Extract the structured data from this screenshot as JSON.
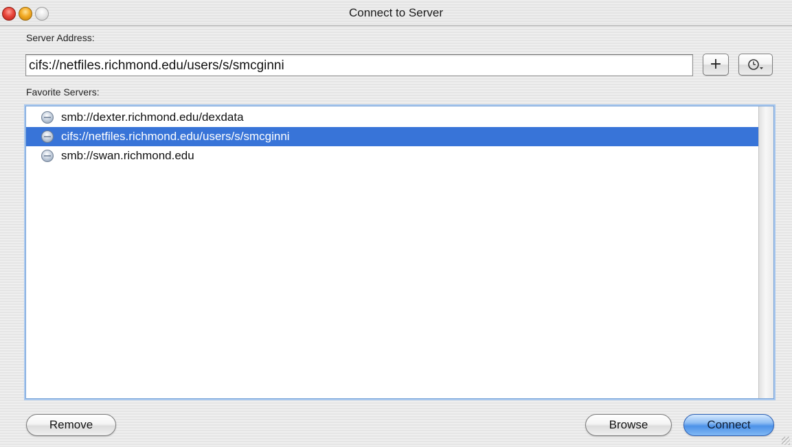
{
  "window": {
    "title": "Connect to Server"
  },
  "server_address": {
    "label": "Server Address:",
    "value": "cifs://netfiles.richmond.edu/users/s/smcginni",
    "add_label": "+",
    "recent_icon": "clock-icon"
  },
  "favorites": {
    "label": "Favorite Servers:",
    "items": [
      {
        "label": "smb://dexter.richmond.edu/dexdata",
        "selected": false
      },
      {
        "label": "cifs://netfiles.richmond.edu/users/s/smcginni",
        "selected": true
      },
      {
        "label": "smb://swan.richmond.edu",
        "selected": false
      }
    ]
  },
  "buttons": {
    "remove": "Remove",
    "browse": "Browse",
    "connect": "Connect"
  },
  "colors": {
    "selection": "#3874d8",
    "default_button": "#4d92e8",
    "close_light": "#e8463b",
    "minimize_light": "#f3ab25"
  }
}
